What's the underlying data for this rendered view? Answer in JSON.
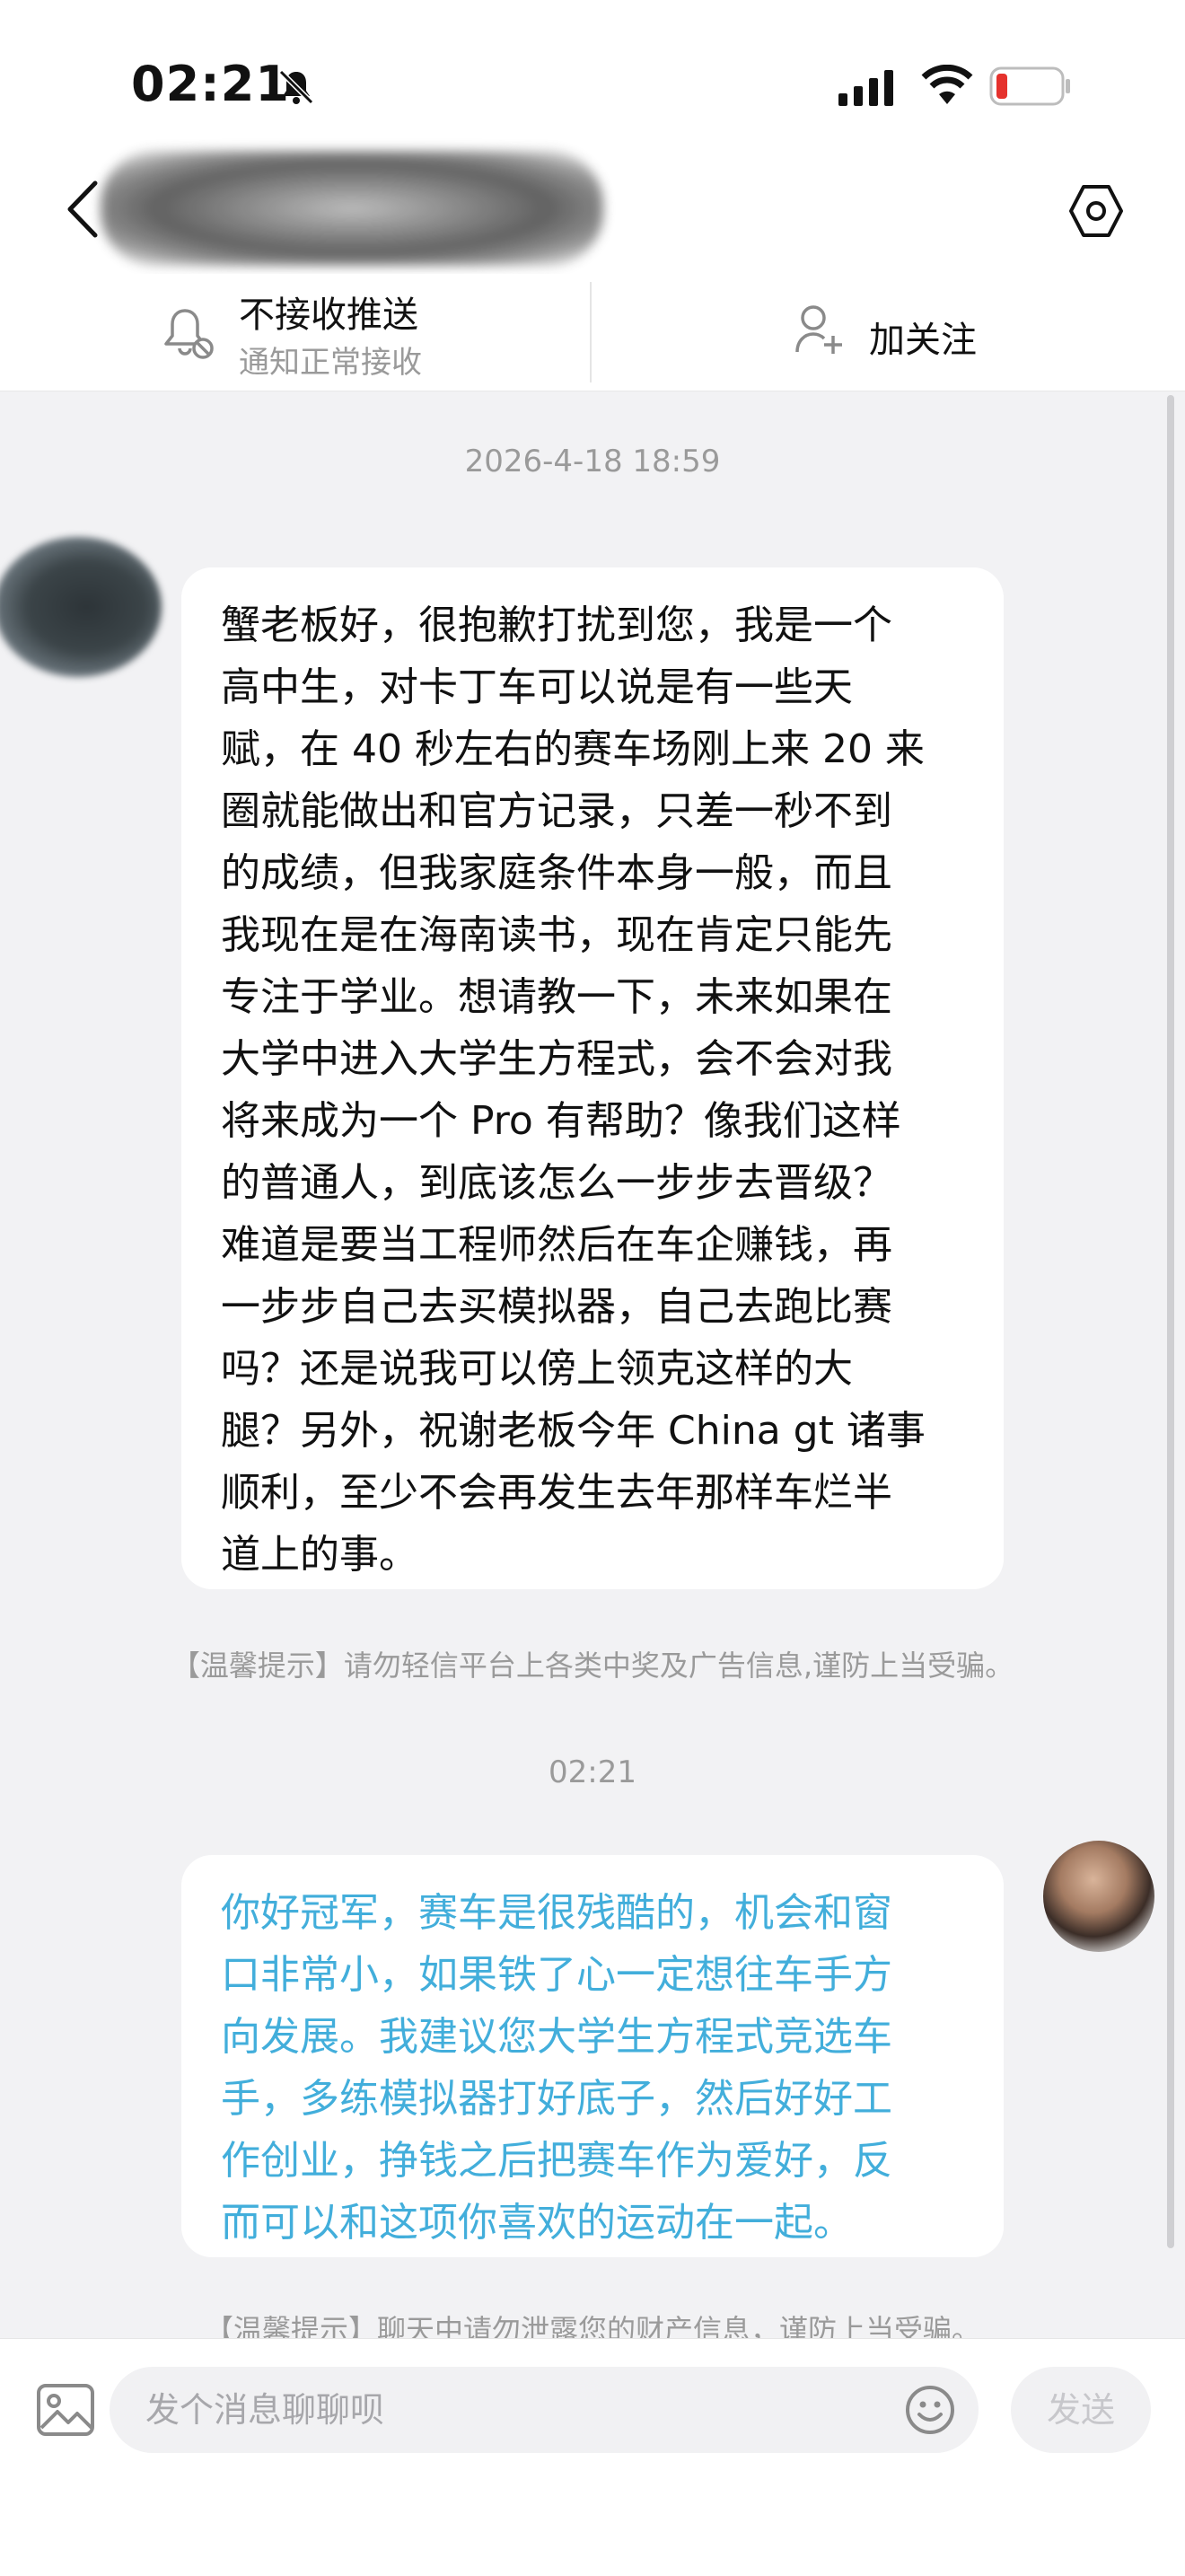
{
  "status_bar": {
    "time": "02:21"
  },
  "header": {
    "mute": {
      "title": "不接收推送",
      "subtitle": "通知正常接收"
    },
    "follow": {
      "label": "加关注"
    }
  },
  "chat": {
    "messages": [
      {
        "timestamp": "2026-4-18 18:59",
        "sender": "left",
        "lines": [
          "蟹老板好，很抱歉打扰到您，我是一个",
          "高中生，对卡丁车可以说是有一些天",
          "赋，在 40 秒左右的赛车场刚上来 20 来",
          "圈就能做出和官方记录，只差一秒不到",
          "的成绩，但我家庭条件本身一般，而且",
          "我现在是在海南读书，现在肯定只能先",
          "专注于学业。想请教一下，未来如果在",
          "大学中进入大学生方程式，会不会对我",
          "将来成为一个 Pro 有帮助？像我们这样",
          "的普通人，到底该怎么一步步去晋级？",
          "难道是要当工程师然后在车企赚钱，再",
          "一步步自己去买模拟器，自己去跑比赛",
          "吗？还是说我可以傍上领克这样的大",
          "腿？另外，祝谢老板今年 China gt 诸事",
          "顺利，至少不会再发生去年那样车烂半",
          "道上的事。"
        ],
        "notice": "【温馨提示】请勿轻信平台上各类中奖及广告信息,谨防上当受骗。"
      },
      {
        "timestamp": "02:21",
        "sender": "right",
        "lines": [
          "你好冠军，赛车是很残酷的，机会和窗",
          "口非常小，如果铁了心一定想往车手方",
          "向发展。我建议您大学生方程式竞选车",
          "手，多练模拟器打好底子，然后好好工",
          "作创业，挣钱之后把赛车作为爱好，反",
          "而可以和这项你喜欢的运动在一起。"
        ],
        "notice": "【温馨提示】聊天中请勿泄露您的财产信息，谨防上当受骗。"
      }
    ]
  },
  "composer": {
    "placeholder": "发个消息聊聊呗",
    "send_label": "发送"
  }
}
